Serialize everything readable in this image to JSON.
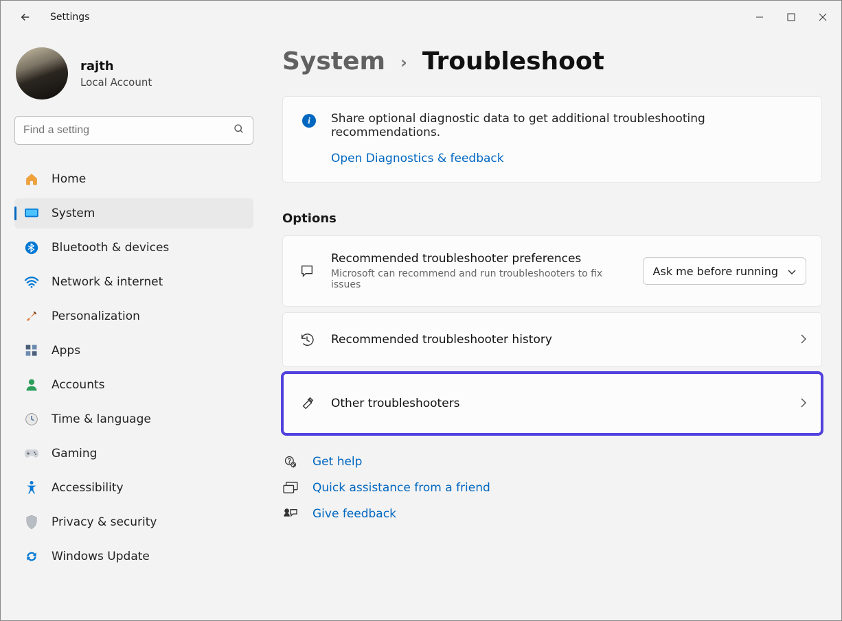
{
  "window": {
    "title": "Settings"
  },
  "user": {
    "name": "rajth",
    "sub": "Local Account"
  },
  "search": {
    "placeholder": "Find a setting"
  },
  "nav": {
    "items": [
      {
        "label": "Home"
      },
      {
        "label": "System"
      },
      {
        "label": "Bluetooth & devices"
      },
      {
        "label": "Network & internet"
      },
      {
        "label": "Personalization"
      },
      {
        "label": "Apps"
      },
      {
        "label": "Accounts"
      },
      {
        "label": "Time & language"
      },
      {
        "label": "Gaming"
      },
      {
        "label": "Accessibility"
      },
      {
        "label": "Privacy & security"
      },
      {
        "label": "Windows Update"
      }
    ]
  },
  "breadcrumb": {
    "parent": "System",
    "current": "Troubleshoot"
  },
  "info": {
    "text": "Share optional diagnostic data to get additional troubleshooting recommendations.",
    "link": "Open Diagnostics & feedback"
  },
  "options_title": "Options",
  "option1": {
    "title": "Recommended troubleshooter preferences",
    "sub": "Microsoft can recommend and run troubleshooters to fix issues",
    "dropdown": "Ask me before running"
  },
  "option2": {
    "title": "Recommended troubleshooter history"
  },
  "option3": {
    "title": "Other troubleshooters"
  },
  "help": {
    "l1": "Get help",
    "l2": "Quick assistance from a friend",
    "l3": "Give feedback"
  }
}
